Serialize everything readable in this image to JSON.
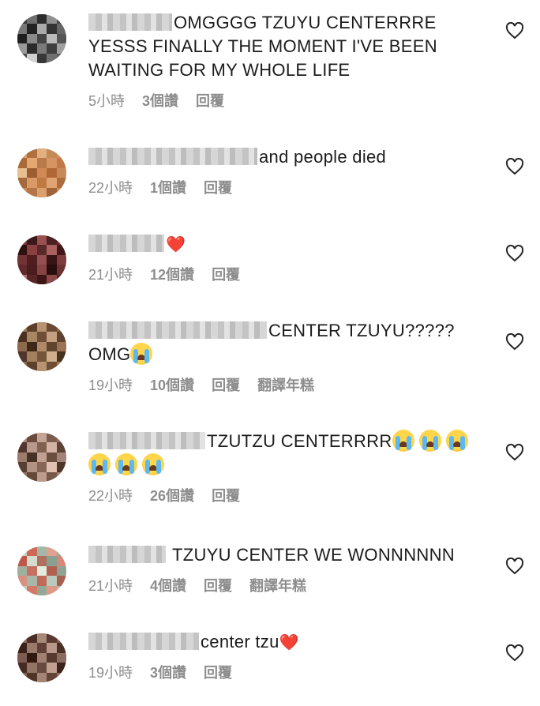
{
  "comments": [
    {
      "user_blur_width": 106,
      "text": "OMGGGG TZUYU CENTERRRE YESSS FINALLY THE MOMENT I'VE BEEN WAITING FOR MY WHOLE LIFE",
      "time": "5小時",
      "likes": "3個讚",
      "reply": "回覆",
      "translate": ""
    },
    {
      "user_blur_width": 214,
      "text": "and people died",
      "time": "22小時",
      "likes": "1個讚",
      "reply": "回覆",
      "translate": ""
    },
    {
      "user_blur_width": 96,
      "text": "",
      "emoji": "❤️",
      "time": "21小時",
      "likes": "12個讚",
      "reply": "回覆",
      "translate": ""
    },
    {
      "user_blur_width": 226,
      "text": "CENTER TZUYU?????",
      "text2": "OMG",
      "time": "19小時",
      "likes": "10個讚",
      "reply": "回覆",
      "translate": "翻譯年糕"
    },
    {
      "user_blur_width": 148,
      "text": "TZUTZU CENTERRRR",
      "time": "22小時",
      "likes": "26個讚",
      "reply": "回覆",
      "translate": ""
    },
    {
      "user_blur_width": 98,
      "text": "TZUYU CENTER WE WONNNNNN",
      "time": "21小時",
      "likes": "4個讚",
      "reply": "回覆",
      "translate": "翻譯年糕"
    },
    {
      "user_blur_width": 140,
      "text": "center tzu",
      "emoji": "❤️",
      "time": "19小時",
      "likes": "3個讚",
      "reply": "回覆",
      "translate": ""
    }
  ],
  "icons": {
    "like": "heart-outline-icon"
  },
  "colors": {
    "text": "#262626",
    "meta": "#8e8e8e",
    "heart": "#ed1c24"
  }
}
